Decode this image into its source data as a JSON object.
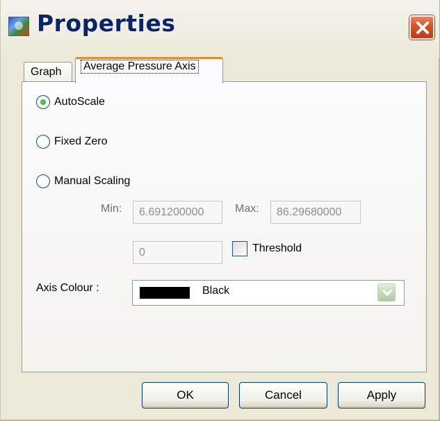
{
  "window": {
    "title": "Properties",
    "icon": "app-icon",
    "close_icon": "close-icon"
  },
  "tabs": [
    {
      "label": "Graph",
      "active": false
    },
    {
      "label": "Average Pressure Axis",
      "active": true
    }
  ],
  "scaling": {
    "options": [
      {
        "label": "AutoScale",
        "checked": true
      },
      {
        "label": "Fixed Zero",
        "checked": false
      },
      {
        "label": "Manual Scaling",
        "checked": false
      }
    ],
    "min_label": "Min:",
    "min_value": "6.691200000",
    "max_label": "Max:",
    "max_value": "86.29680000",
    "threshold_value": "0",
    "threshold_label": "Threshold",
    "threshold_checked": false
  },
  "axis_colour": {
    "label": "Axis Colour :",
    "selected": "Black",
    "swatch_color": "#000000"
  },
  "buttons": {
    "ok": "OK",
    "cancel": "Cancel",
    "apply": "Apply"
  }
}
